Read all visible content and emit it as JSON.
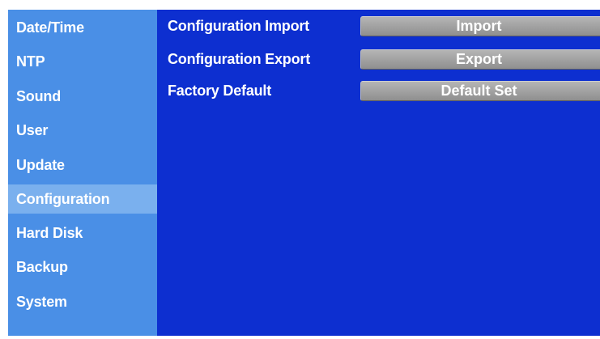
{
  "sidebar": {
    "items": [
      {
        "label": "Date/Time"
      },
      {
        "label": "NTP"
      },
      {
        "label": "Sound"
      },
      {
        "label": "User"
      },
      {
        "label": "Update"
      },
      {
        "label": "Configuration",
        "active": true
      },
      {
        "label": "Hard Disk"
      },
      {
        "label": "Backup"
      },
      {
        "label": "System"
      }
    ]
  },
  "main": {
    "rows": [
      {
        "label": "Configuration Import",
        "button": "Import"
      },
      {
        "label": "Configuration Export",
        "button": "Export"
      },
      {
        "label": "Factory Default",
        "button": "Default Set"
      }
    ]
  },
  "colors": {
    "sidebar_bg": "#4a8fe6",
    "sidebar_active_bg": "#7ab0ee",
    "main_bg": "#0d2fd0",
    "button_bg": "#a3a3a3",
    "text": "#ffffff"
  }
}
